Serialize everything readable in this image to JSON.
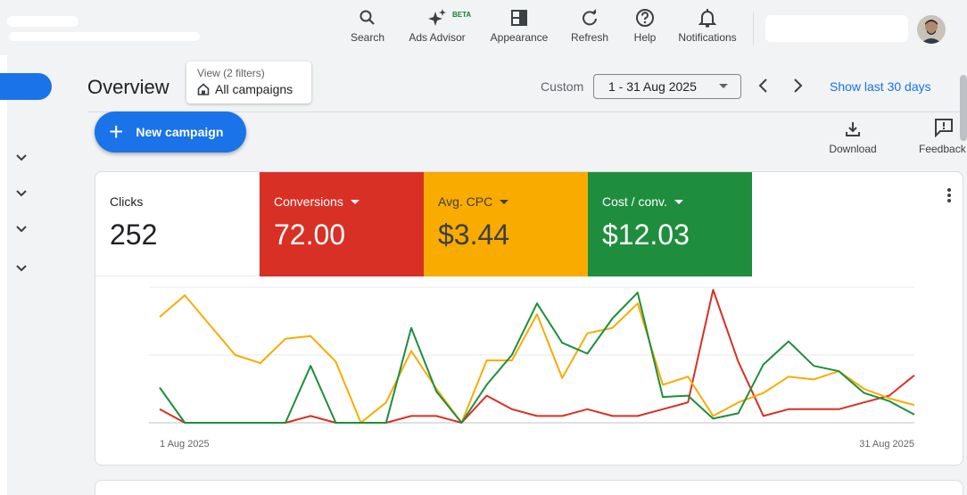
{
  "topbar": {
    "items": [
      {
        "label": "Search",
        "icon": "search-icon"
      },
      {
        "label": "Ads Advisor",
        "icon": "sparkle-icon",
        "badge": "BETA"
      },
      {
        "label": "Appearance",
        "icon": "appearance-icon"
      },
      {
        "label": "Refresh",
        "icon": "refresh-icon"
      },
      {
        "label": "Help",
        "icon": "help-icon"
      },
      {
        "label": "Notifications",
        "icon": "bell-icon"
      }
    ]
  },
  "header": {
    "title": "Overview",
    "view_sub": "View (2 filters)",
    "view_main": "All campaigns",
    "custom_label": "Custom",
    "date_range": "1 - 31 Aug 2025",
    "show_last": "Show last 30 days"
  },
  "actions": {
    "new_campaign": "New campaign",
    "download": "Download",
    "feedback": "Feedback"
  },
  "metrics": {
    "clicks": {
      "label": "Clicks",
      "value": "252"
    },
    "conversions": {
      "label": "Conversions",
      "value": "72.00",
      "color": "#d93025"
    },
    "avg_cpc": {
      "label": "Avg. CPC",
      "value": "$3.44",
      "color": "#f9ab00"
    },
    "cost_conv": {
      "label": "Cost / conv.",
      "value": "$12.03",
      "color": "#1e8e3e"
    }
  },
  "chart_data": {
    "type": "line",
    "x_start_label": "1 Aug 2025",
    "x_end_label": "31 Aug 2025",
    "x": [
      1,
      2,
      3,
      4,
      5,
      6,
      7,
      8,
      9,
      10,
      11,
      12,
      13,
      14,
      15,
      16,
      17,
      18,
      19,
      20,
      21,
      22,
      23,
      24,
      25,
      26,
      27,
      28,
      29,
      30,
      31
    ],
    "ylim": [
      0,
      1
    ],
    "grid": true,
    "series": [
      {
        "color": "#d93025",
        "values": [
          0.1,
          0,
          0,
          0,
          0,
          0,
          0.05,
          0,
          0,
          0,
          0.05,
          0.05,
          0,
          0.2,
          0.1,
          0.05,
          0.05,
          0.1,
          0.05,
          0.05,
          0.1,
          0.15,
          0.98,
          0.45,
          0.05,
          0.1,
          0.1,
          0.1,
          0.15,
          0.2,
          0.35
        ]
      },
      {
        "color": "#f9ab00",
        "values": [
          0.78,
          0.94,
          0.72,
          0.5,
          0.44,
          0.62,
          0.64,
          0.45,
          0,
          0.15,
          0.53,
          0.25,
          0,
          0.46,
          0.46,
          0.8,
          0.33,
          0.66,
          0.7,
          0.88,
          0.28,
          0.34,
          0.05,
          0.15,
          0.22,
          0.34,
          0.32,
          0.38,
          0.25,
          0.18,
          0.13
        ]
      },
      {
        "color": "#1e8e3e",
        "values": [
          0.26,
          0,
          0,
          0,
          0,
          0,
          0.42,
          0,
          0,
          0,
          0.7,
          0.23,
          0,
          0.28,
          0.5,
          0.88,
          0.59,
          0.51,
          0.77,
          0.96,
          0.19,
          0.2,
          0.03,
          0.07,
          0.43,
          0.6,
          0.42,
          0.38,
          0.22,
          0.16,
          0.06
        ]
      }
    ]
  }
}
